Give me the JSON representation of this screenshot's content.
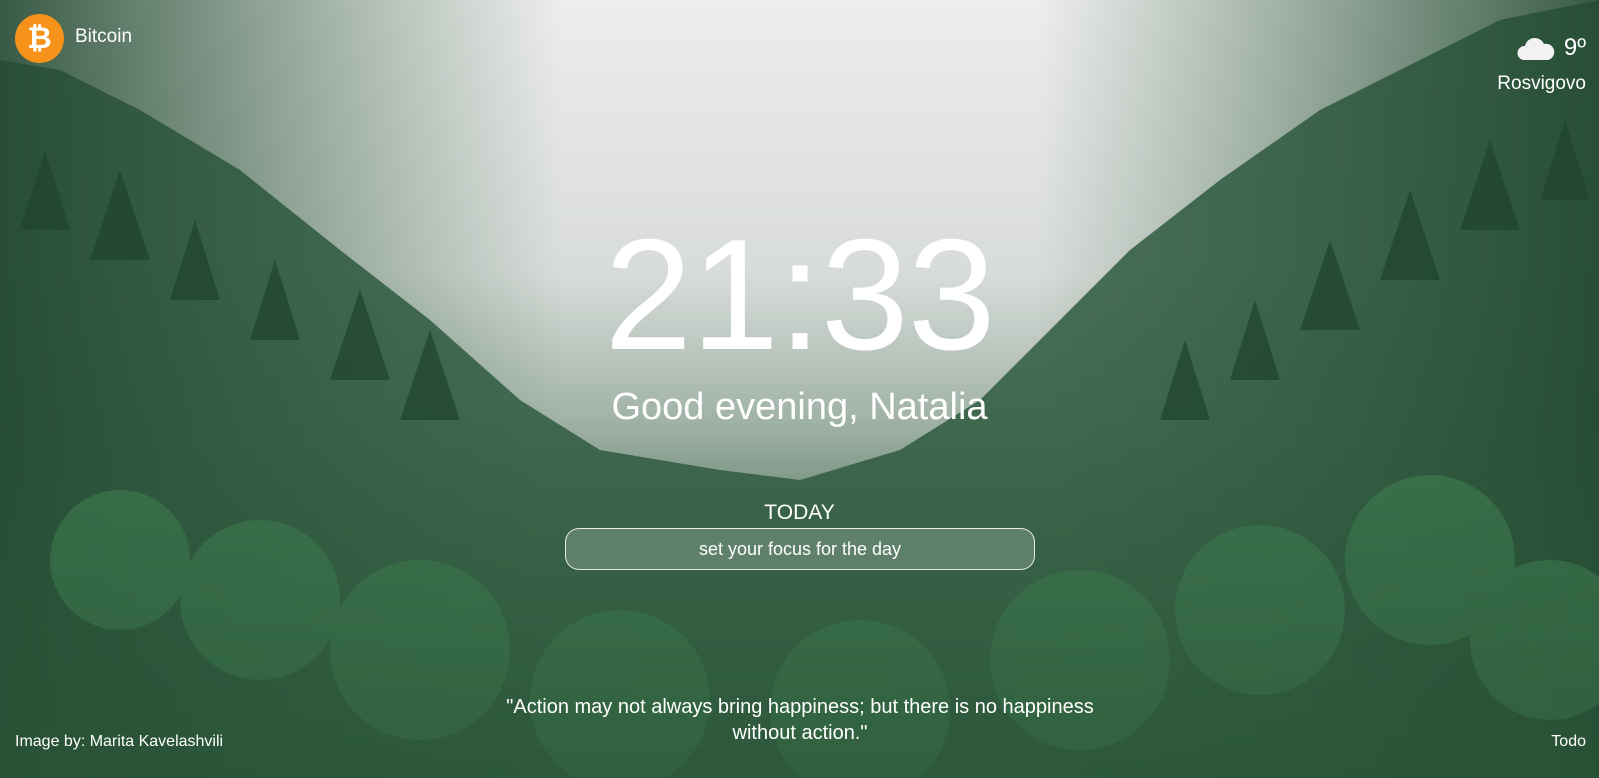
{
  "crypto": {
    "name": "Bitcoin",
    "icon": "bitcoin-icon",
    "icon_symbol": "₿",
    "icon_color": "#f7931a"
  },
  "weather": {
    "temperature": "9º",
    "city": "Rosvigovo",
    "icon": "cloudy-night-icon"
  },
  "clock": {
    "time": "21:33"
  },
  "greeting": {
    "text": "Good evening, Natalia"
  },
  "focus": {
    "title": "TODAY",
    "placeholder": "set your focus for the day"
  },
  "quote": {
    "text": "\"Action may not always bring happiness; but there is no happiness without action.\""
  },
  "credit": {
    "text": "Image by: Marita Kavelashvili"
  },
  "todo": {
    "label": "Todo"
  },
  "background": {
    "description_icon": "foggy-forest-background",
    "sky_color": "#e9ebea",
    "forest_color": "#2f5a3d"
  }
}
